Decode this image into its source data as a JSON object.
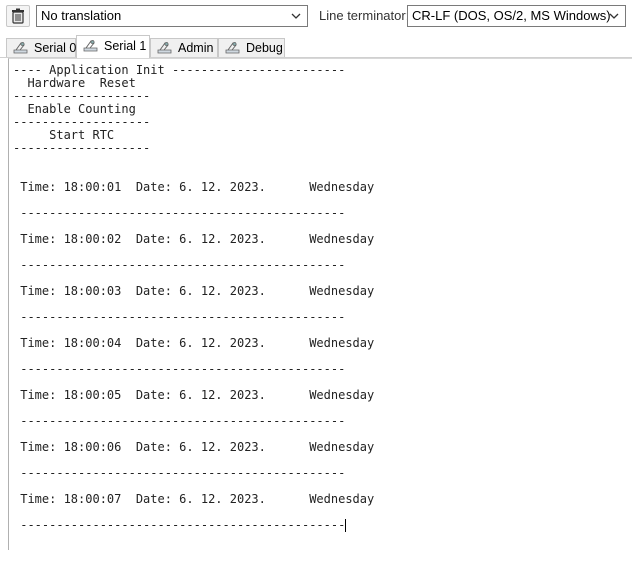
{
  "toolbar": {
    "translation_select": "No translation",
    "line_terminator_label": "Line terminator:",
    "line_terminator_select": "CR-LF  (DOS, OS/2, MS Windows)"
  },
  "tabs": [
    {
      "label": "Serial 0",
      "active": false
    },
    {
      "label": "Serial 1",
      "active": true
    },
    {
      "label": "Admin",
      "active": false
    },
    {
      "label": "Debug",
      "active": false
    }
  ],
  "terminal": {
    "lines": [
      "---- Application Init ------------------------",
      "  Hardware  Reset",
      "-------------------",
      "  Enable Counting",
      "-------------------",
      "     Start RTC",
      "-------------------",
      "",
      "",
      " Time: 18:00:01  Date: 6. 12. 2023.      Wednesday",
      "",
      " ---------------------------------------------",
      "",
      " Time: 18:00:02  Date: 6. 12. 2023.      Wednesday",
      "",
      " ---------------------------------------------",
      "",
      " Time: 18:00:03  Date: 6. 12. 2023.      Wednesday",
      "",
      " ---------------------------------------------",
      "",
      " Time: 18:00:04  Date: 6. 12. 2023.      Wednesday",
      "",
      " ---------------------------------------------",
      "",
      " Time: 18:00:05  Date: 6. 12. 2023.      Wednesday",
      "",
      " ---------------------------------------------",
      "",
      " Time: 18:00:06  Date: 6. 12. 2023.      Wednesday",
      "",
      " ---------------------------------------------",
      "",
      " Time: 18:00:07  Date: 6. 12. 2023.      Wednesday",
      "",
      " ---------------------------------------------"
    ]
  }
}
